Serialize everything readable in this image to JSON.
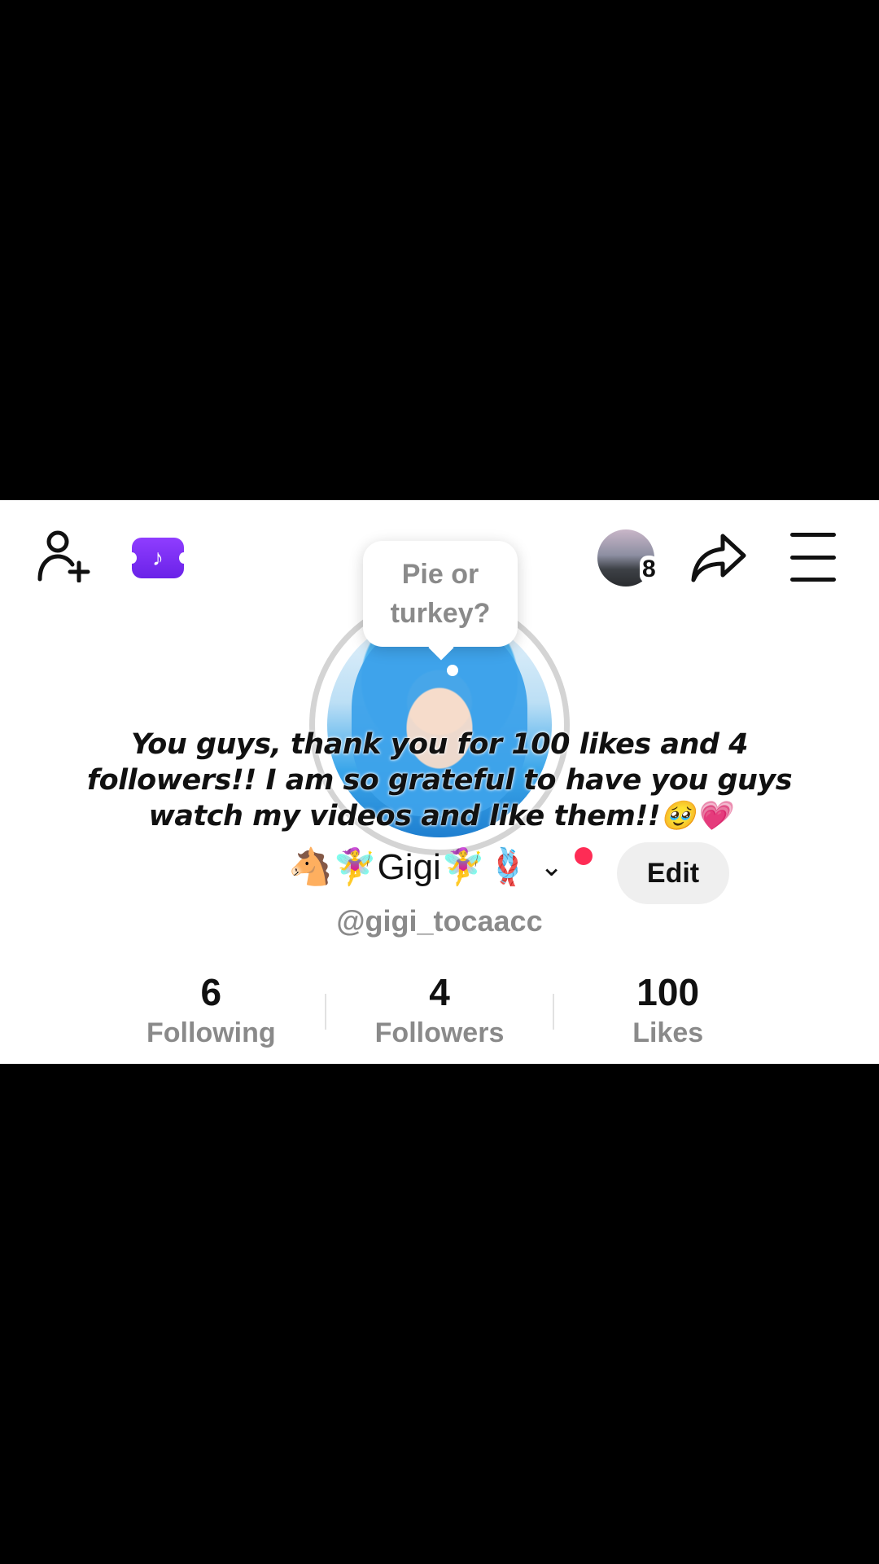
{
  "profile": {
    "bubble_line1": "Pie or",
    "bubble_line2": "turkey?",
    "display_name": "🐴🧚‍♀️Gigi🧚‍♀️🪢",
    "chevron": "⌄",
    "edit_label": "Edit",
    "handle": "@gigi_tocaacc",
    "story_count": "8",
    "ticket_glyph": "♪"
  },
  "overlay_text": "You guys, thank you for 100 likes and 4 followers!! I am so grateful to have you guys watch my videos and like them!!🥹💗",
  "stats": [
    {
      "value": "6",
      "label": "Following"
    },
    {
      "value": "4",
      "label": "Followers"
    },
    {
      "value": "100",
      "label": "Likes"
    }
  ],
  "icons": {
    "add_user": "add-user-icon",
    "ticket": "tiktok-ticket-icon",
    "share": "share-icon",
    "menu": "menu-icon"
  },
  "colors": {
    "accent_red": "#fe2c55",
    "ticket_purple": "#7b2ff2",
    "muted_text": "#8a8a8a"
  }
}
